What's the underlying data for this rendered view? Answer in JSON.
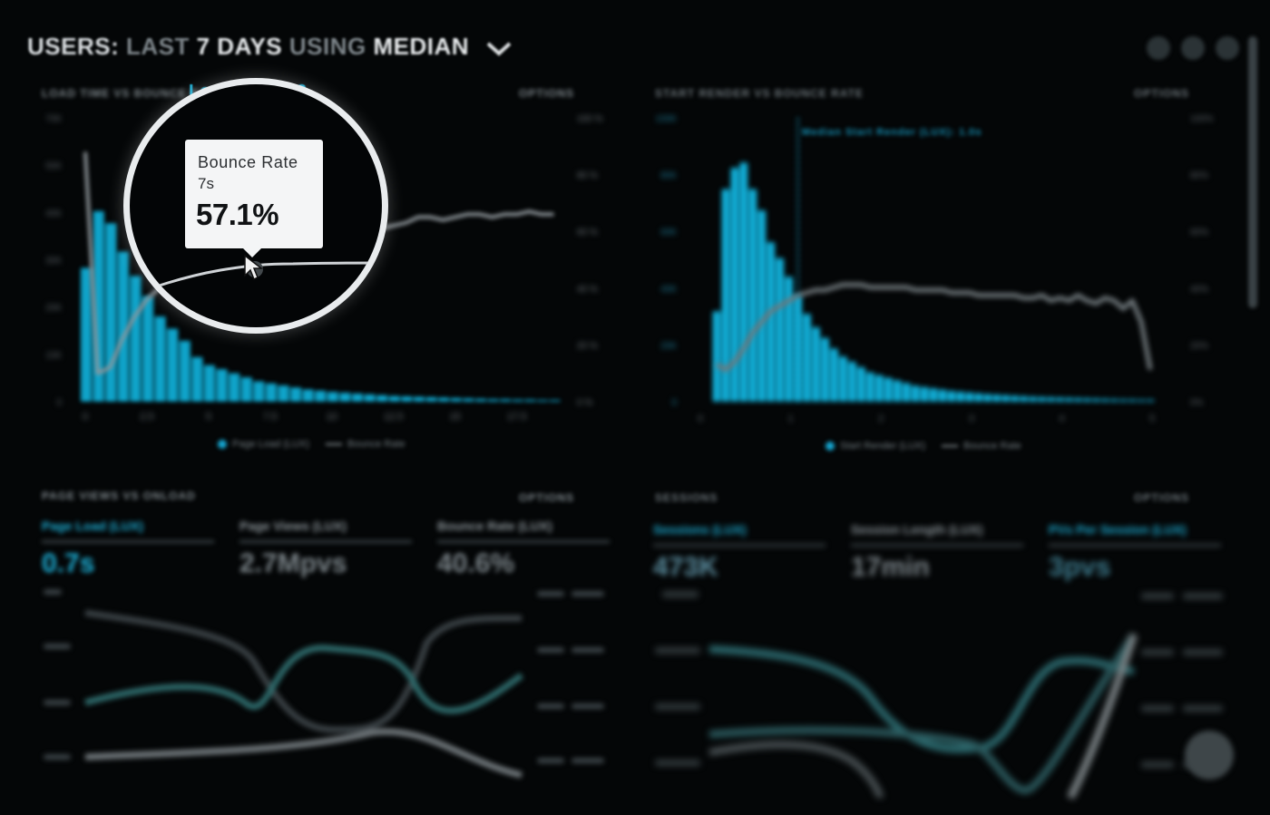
{
  "header": {
    "title_part1": "USERS:",
    "title_part2": "LAST",
    "title_part3": "7 DAYS",
    "title_part4": "USING",
    "title_part5": "MEDIAN"
  },
  "panels": {
    "top_left": {
      "heading_prefix": "LOAD TIME VS BOUNCE RATE",
      "heading_accent": "Load (LUX): 2.",
      "options": "OPTIONS",
      "legend_bars": "Page Load (LUX)",
      "legend_line": "Bounce Rate"
    },
    "top_right": {
      "heading": "START RENDER VS BOUNCE RATE",
      "options": "OPTIONS",
      "annotation": "Median Start Render (LUX): 1.0s",
      "legend_bars": "Start Render (LUX)",
      "legend_line": "Bounce Rate"
    },
    "bottom_left": {
      "heading": "PAGE VIEWS VS ONLOAD",
      "options": "OPTIONS",
      "stats": [
        {
          "label": "Page Load (LUX)",
          "value": "0.7s"
        },
        {
          "label": "Page Views (LUX)",
          "value": "2.7Mpvs"
        },
        {
          "label": "Bounce Rate (LUX)",
          "value": "40.6%"
        }
      ]
    },
    "bottom_right": {
      "heading": "SESSIONS",
      "options": "OPTIONS",
      "stats": [
        {
          "label": "Sessions (LUX)",
          "value": "473K"
        },
        {
          "label": "Session Length (LUX)",
          "value": "17min"
        },
        {
          "label": "PVs Per Session (LUX)",
          "value": "3pvs"
        }
      ]
    }
  },
  "tooltip": {
    "label": "Bounce Rate",
    "x_value": "7s",
    "value": "57.1%"
  },
  "colors": {
    "accent": "#16a9d4",
    "bar": "#0fa3c9",
    "line_gray": "#8d9499",
    "line_teal": "#2f7575",
    "background": "#040607"
  },
  "chart_data": [
    {
      "type": "bar",
      "x": [
        0,
        0.5,
        1,
        1.5,
        2,
        2.5,
        3,
        3.5,
        4,
        4.5,
        5,
        5.5,
        6,
        6.5,
        7,
        7.5,
        8,
        8.5,
        9,
        9.5,
        10,
        10.5,
        11,
        11.5,
        12,
        12.5,
        13,
        13.5,
        14,
        14.5,
        15,
        15.5,
        16,
        16.5,
        17,
        17.5,
        18,
        18.5,
        19
      ],
      "values": [
        33,
        47,
        44,
        37,
        31,
        26,
        21,
        18,
        15,
        11,
        9,
        8,
        7,
        6,
        5,
        4.5,
        4,
        3.5,
        3,
        2.7,
        2.4,
        2.2,
        2,
        1.8,
        1.6,
        1.4,
        1.3,
        1.2,
        1.1,
        1,
        0.9,
        0.8,
        0.7,
        0.6,
        0.6,
        0.5,
        0.5,
        0.4,
        0.4
      ],
      "line": [
        88,
        10,
        12,
        22,
        30,
        36,
        40,
        42,
        44,
        46,
        48,
        50,
        51,
        52,
        53,
        54,
        55,
        55,
        56,
        56,
        57,
        57,
        58,
        60,
        61,
        62,
        63,
        65,
        65,
        64,
        65,
        66,
        66,
        65,
        66,
        66,
        67,
        66,
        66
      ],
      "y_ticks": [
        "0",
        "10K",
        "20K",
        "30K",
        "40K",
        "50K",
        "70K"
      ],
      "y2_ticks": [
        "0 %",
        "20 %",
        "40 %",
        "60 %",
        "80 %",
        "100 %"
      ],
      "x_ticks": [
        "0",
        "2.5",
        "5",
        "7.5",
        "10",
        "12.5",
        "15",
        "17.5"
      ]
    },
    {
      "type": "bar",
      "x": [
        0.1,
        0.2,
        0.3,
        0.4,
        0.5,
        0.6,
        0.7,
        0.8,
        0.9,
        1,
        1.1,
        1.2,
        1.3,
        1.4,
        1.5,
        1.6,
        1.7,
        1.8,
        1.9,
        2,
        2.1,
        2.2,
        2.3,
        2.4,
        2.5,
        2.6,
        2.7,
        2.8,
        2.9,
        3,
        3.1,
        3.2,
        3.3,
        3.4,
        3.5,
        3.6,
        3.7,
        3.8,
        3.9,
        4,
        4.1,
        4.2,
        4.3,
        4.4,
        4.5,
        4.6,
        4.7,
        4.8,
        4.9
      ],
      "values": [
        34,
        80,
        88,
        90,
        80,
        72,
        60,
        54,
        47,
        40,
        33,
        28,
        24,
        20,
        17,
        15,
        13,
        11,
        10,
        9,
        8,
        7,
        6,
        5.5,
        5,
        4.5,
        4,
        3.7,
        3.4,
        3.1,
        2.8,
        2.6,
        2.4,
        2.2,
        2,
        1.8,
        1.7,
        1.6,
        1.5,
        1.4,
        1.3,
        1.2,
        1.1,
        1,
        0.9,
        0.8,
        0.8,
        0.7,
        0.7
      ],
      "line": [
        14,
        12,
        15,
        20,
        26,
        30,
        34,
        36,
        38,
        40,
        41,
        42,
        42,
        43,
        44,
        44,
        44,
        43,
        43,
        43,
        43,
        43,
        42,
        42,
        42,
        42,
        41,
        41,
        41,
        40,
        40,
        40,
        40,
        40,
        39,
        39,
        40,
        38,
        39,
        38,
        40,
        38,
        37,
        39,
        38,
        35,
        38,
        30,
        12
      ],
      "x_ticks": [
        "0",
        "1",
        "2",
        "3",
        "4",
        "5"
      ]
    }
  ]
}
